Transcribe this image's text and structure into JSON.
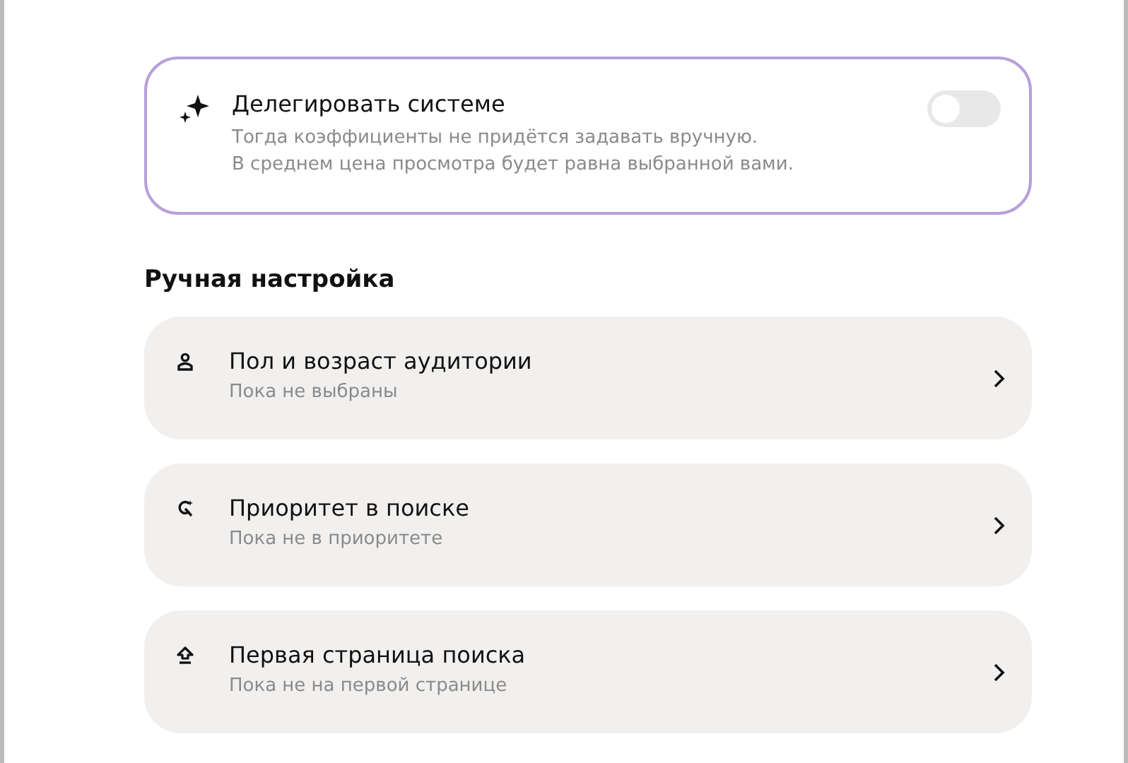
{
  "delegate": {
    "title": "Делегировать системе",
    "lines": [
      "Тогда коэффициенты не придётся задавать вручную.",
      "В среднем цена просмотра будет равна выбранной вами."
    ],
    "on": false
  },
  "section_title": "Ручная настройка",
  "settings": [
    {
      "title": "Пол и возраст аудитории",
      "subtitle": "Пока не выбраны"
    },
    {
      "title": "Приоритет в поиске",
      "subtitle": "Пока не в приоритете"
    },
    {
      "title": "Первая страница поиска",
      "subtitle": "Пока не на первой странице"
    }
  ]
}
